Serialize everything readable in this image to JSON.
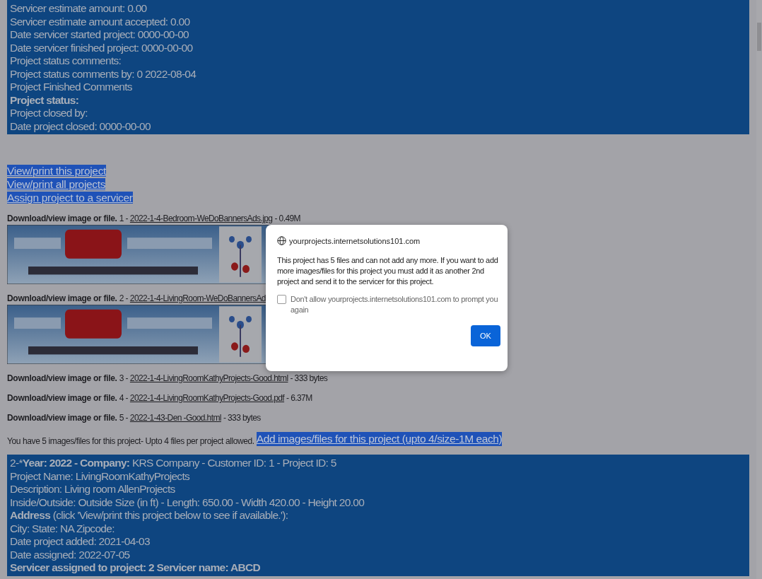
{
  "project_panel": {
    "lines": [
      {
        "segments": [
          {
            "text": "Servicer estimate amount: 0.00",
            "bold": false
          }
        ]
      },
      {
        "segments": [
          {
            "text": "Servicer estimate amount accepted: 0.00",
            "bold": false
          }
        ]
      },
      {
        "segments": [
          {
            "text": "Date servicer started project: 0000-00-00",
            "bold": false
          }
        ]
      },
      {
        "segments": [
          {
            "text": "Date servicer finished project: 0000-00-00",
            "bold": false
          }
        ]
      },
      {
        "segments": [
          {
            "text": "Project status comments:",
            "bold": false
          }
        ]
      },
      {
        "segments": [
          {
            "text": "Project status comments by: 0 2022-08-04",
            "bold": false
          }
        ]
      },
      {
        "segments": [
          {
            "text": "Project Finished Comments",
            "bold": false
          }
        ]
      },
      {
        "segments": [
          {
            "text": "Project status:",
            "bold": true
          }
        ]
      },
      {
        "segments": [
          {
            "text": "Project closed by:",
            "bold": false
          }
        ]
      },
      {
        "segments": [
          {
            "text": "Date project closed: 0000-00-00",
            "bold": false
          }
        ]
      }
    ]
  },
  "links": [
    "View/print this project",
    "View/print all projects",
    "Assign project to a servicer"
  ],
  "files": [
    {
      "label": "Download/view image or file.",
      "number": "1 -",
      "name": "2022-1-4-Bedroom-WeDoBannersAds.jpg",
      "size": "- 0.49M",
      "kind": "picture"
    },
    {
      "label": "Download/view image or file.",
      "number": "2 -",
      "name": "2022-1-4-LivingRoom-WeDoBannersAd",
      "kind": "picture"
    },
    {
      "label": "Download/view image or file.",
      "number": "3 -",
      "name": "2022-1-4-LivingRoomKathyProjects-Good.html",
      "size": "- 333 bytes"
    },
    {
      "label": "Download/view image or file.",
      "number": "4 -",
      "name": "2022-1-4-LivingRoomKathyProjects-Good.pdf",
      "size": "- 6.37M"
    },
    {
      "label": "Download/view image or file.",
      "number": "5 -",
      "name": "2022-1-43-Den -Good.html",
      "size": "- 333 bytes"
    }
  ],
  "files_note": "You have 5 images/files for this project- Upto 4 files per project allowed.",
  "add_link": "Add images/files for this project (upto 4/size-1M each)",
  "next_panel": {
    "lines": [
      {
        "segments": [
          {
            "text": "2-*",
            "bold": false
          },
          {
            "text": "Year: 2022 - Company:",
            "bold": true
          },
          {
            "text": " KRS Company - Customer ID: 1 - Project ID: 5",
            "bold": false
          }
        ]
      },
      {
        "segments": [
          {
            "text": "Project Name: LivingRoomKathyProjects",
            "bold": false
          }
        ]
      },
      {
        "segments": [
          {
            "text": "Description: Living room AllenProjects",
            "bold": false
          }
        ]
      },
      {
        "segments": [
          {
            "text": "Inside/Outside: Outside Size (in ft) - Length: 650.00 - Width 420.00 - Height 20.00",
            "bold": false
          }
        ]
      },
      {
        "segments": [
          {
            "text": "Address",
            "bold": true
          },
          {
            "text": " (click 'View/print this project below to see if available.'):",
            "bold": false
          }
        ]
      },
      {
        "segments": [
          {
            "text": "City: State: NA Zipcode:",
            "bold": false
          }
        ]
      },
      {
        "segments": [
          {
            "text": "Date project added: 2021-04-03",
            "bold": false
          }
        ]
      },
      {
        "segments": [
          {
            "text": "Date assigned: 2022-07-05",
            "bold": false
          }
        ]
      },
      {
        "segments": [
          {
            "text": "Servicer assigned to project: 2 Servicer name: ABCD",
            "bold": true
          }
        ]
      }
    ]
  },
  "dialog": {
    "origin": "yourprojects.internetsolutions101.com",
    "message": "This project has 5 files and can not add any more.  If you want to add more images/files for this project you must add it as another 2nd project and send it to the servicer for this project.",
    "checkbox": {
      "label": "Don't allow yourprojects.internetsolutions101.com to prompt you again",
      "checked": false
    },
    "button": "OK"
  }
}
